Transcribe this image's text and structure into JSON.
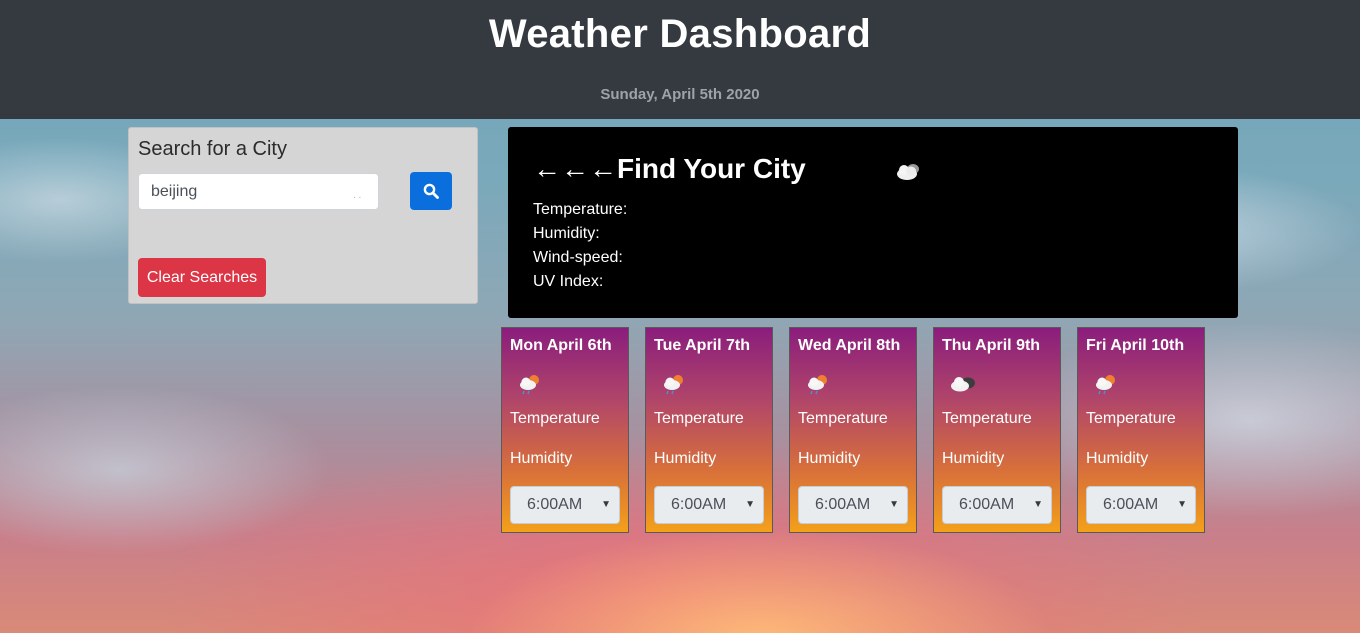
{
  "header": {
    "title": "Weather Dashboard",
    "date": "Sunday, April 5th 2020"
  },
  "search": {
    "title": "Search for a City",
    "value": "beijing",
    "hint": ". .",
    "search_icon": "search-icon",
    "clear_label": "Clear Searches"
  },
  "current": {
    "city": "←←←Find Your City",
    "icon": "cloud-icon",
    "temperature_label": "Temperature:",
    "humidity_label": "Humidity:",
    "wind_label": "Wind-speed:",
    "uv_label": "UV Index:"
  },
  "forecast": [
    {
      "day": "Mon April 6th",
      "icon": "cloud-sun-rain-icon",
      "temperature": "Temperature",
      "humidity": "Humidity",
      "time": "6:00AM"
    },
    {
      "day": "Tue April 7th",
      "icon": "cloud-sun-rain-icon",
      "temperature": "Temperature",
      "humidity": "Humidity",
      "time": "6:00AM"
    },
    {
      "day": "Wed April 8th",
      "icon": "cloud-sun-rain-icon",
      "temperature": "Temperature",
      "humidity": "Humidity",
      "time": "6:00AM"
    },
    {
      "day": "Thu April 9th",
      "icon": "cloud-dark-icon",
      "temperature": "Temperature",
      "humidity": "Humidity",
      "time": "6:00AM"
    },
    {
      "day": "Fri April 10th",
      "icon": "cloud-sun-rain-icon",
      "temperature": "Temperature",
      "humidity": "Humidity",
      "time": "6:00AM"
    }
  ],
  "colors": {
    "header_bg": "#343a40",
    "search_btn": "#0a6fdc",
    "clear_btn": "#dc3545",
    "card_top": "#8a1d7c",
    "card_bottom": "#f3a01a"
  }
}
